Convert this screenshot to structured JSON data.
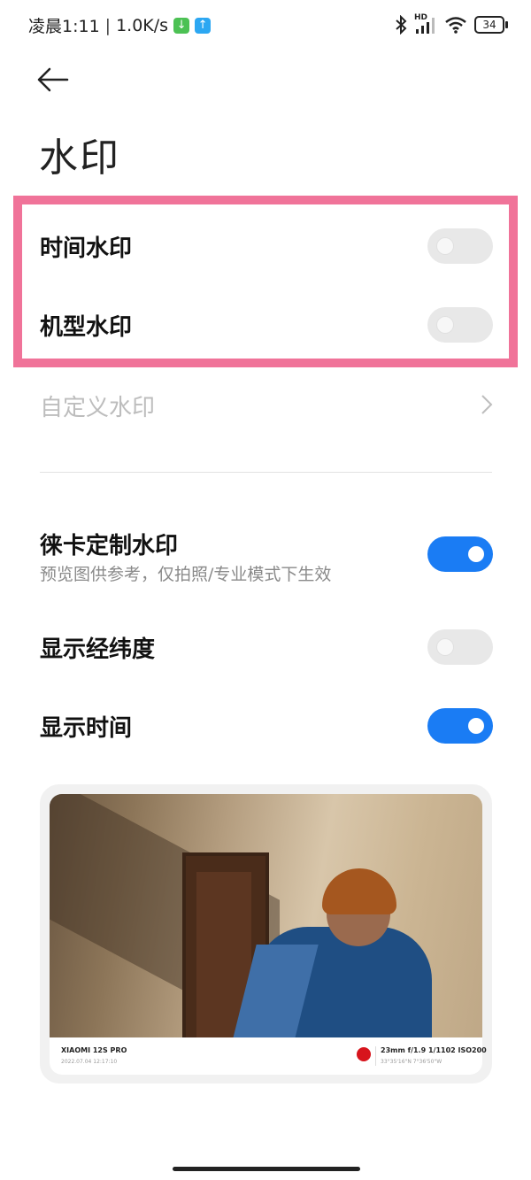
{
  "status_bar": {
    "time": "凌晨1:11",
    "speed": "1.0K/s",
    "hd": "HD",
    "battery": "34",
    "icons": [
      "download-notification-icon",
      "upload-notification-icon",
      "bluetooth-icon",
      "signal-icon",
      "wifi-icon",
      "battery-icon"
    ]
  },
  "header": {
    "title": "水印"
  },
  "settings": {
    "time_watermark": {
      "label": "时间水印",
      "enabled": false
    },
    "model_watermark": {
      "label": "机型水印",
      "enabled": false
    },
    "custom_watermark": {
      "label": "自定义水印"
    },
    "leica_watermark": {
      "label": "徕卡定制水印",
      "subtitle": "预览图供参考，仅拍照/专业模式下生效",
      "enabled": true
    },
    "show_coordinates": {
      "label": "显示经纬度",
      "enabled": false
    },
    "show_time": {
      "label": "显示时间",
      "enabled": true
    }
  },
  "preview": {
    "model": "XIAOMI 12S PRO",
    "date": "2022.07.04   12:17:10",
    "params": "23mm  f/1.9  1/1102  ISO200",
    "coords": "33°35'16\"N   7°36'50\"W"
  },
  "colors": {
    "accent": "#1a7cf4",
    "highlight": "#f07399",
    "toggle_off": "#e8e8e8"
  }
}
